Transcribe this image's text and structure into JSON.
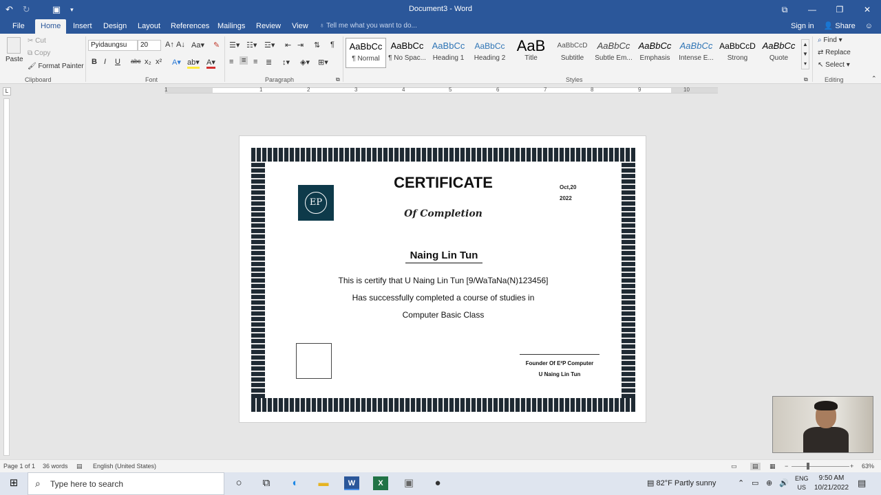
{
  "window": {
    "title": "Document3 - Word",
    "controls": [
      "⧉",
      "—",
      "❐",
      "✕"
    ]
  },
  "tabs": [
    "File",
    "Home",
    "Insert",
    "Design",
    "Layout",
    "References",
    "Mailings",
    "Review",
    "View"
  ],
  "tell_me": "Tell me what you want to do...",
  "account": {
    "sign_in": "Sign in",
    "share": "Share"
  },
  "clipboard": {
    "paste": "Paste",
    "cut": "Cut",
    "copy": "Copy",
    "format_painter": "Format Painter",
    "label": "Clipboard"
  },
  "font": {
    "name": "Pyidaungsu",
    "size": "20",
    "label": "Font"
  },
  "paragraph": {
    "label": "Paragraph"
  },
  "styles": {
    "label": "Styles",
    "items": [
      {
        "preview": "AaBbCc",
        "name": "¶ Normal"
      },
      {
        "preview": "AaBbCc",
        "name": "¶ No Spac..."
      },
      {
        "preview": "AaBbCc",
        "name": "Heading 1"
      },
      {
        "preview": "AaBbCc",
        "name": "Heading 2"
      },
      {
        "preview": "AaB",
        "name": "Title"
      },
      {
        "preview": "AaBbCcD",
        "name": "Subtitle"
      },
      {
        "preview": "AaBbCc",
        "name": "Subtle Em..."
      },
      {
        "preview": "AaBbCc",
        "name": "Emphasis"
      },
      {
        "preview": "AaBbCc",
        "name": "Intense E..."
      },
      {
        "preview": "AaBbCcD",
        "name": "Strong"
      },
      {
        "preview": "AaBbCc",
        "name": "Quote"
      }
    ]
  },
  "editing": {
    "find": "Find",
    "replace": "Replace",
    "select": "Select",
    "label": "Editing"
  },
  "ruler_numbers": [
    "1",
    "1",
    "2",
    "3",
    "4",
    "5",
    "6",
    "7",
    "8",
    "9",
    "10"
  ],
  "certificate": {
    "logo_text": "EP",
    "title": "CERTIFICATE",
    "subtitle": "Of Completion",
    "date_line1": "Oct,20",
    "date_line2": "2022",
    "name": "Naing Lin Tun",
    "line1": "This is certify that U Naing Lin Tun [9/WaTaNa(N)123456]",
    "line2": "Has successfully completed a course of studies in",
    "line3": "Computer Basic Class",
    "founder_line1": "Founder Of E²P Computer",
    "founder_line2": "U Naing Lin Tun"
  },
  "status": {
    "page": "Page 1 of 1",
    "words": "36 words",
    "language": "English (United States)",
    "zoom": "63%"
  },
  "taskbar": {
    "search_placeholder": "Type here to search",
    "weather": "82°F  Partly sunny",
    "lang1": "ENG",
    "lang2": "US",
    "time": "9:50 AM",
    "date": "10/21/2022"
  }
}
